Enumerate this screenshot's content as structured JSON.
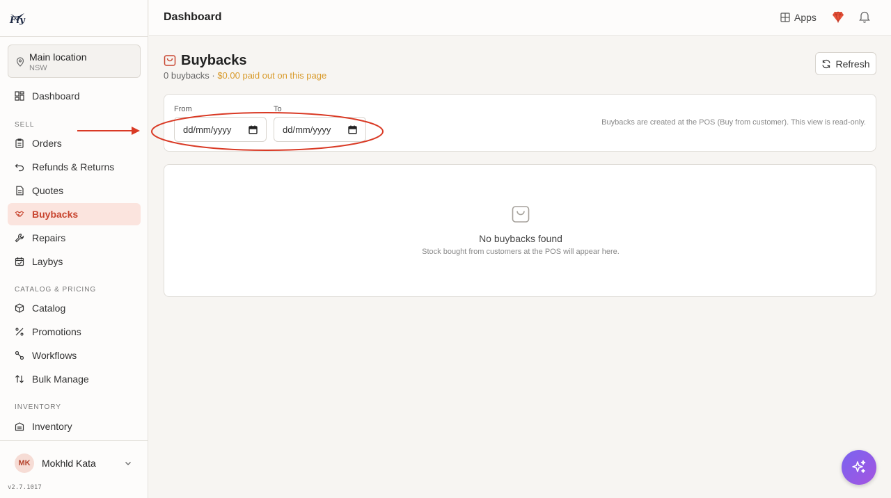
{
  "app": {
    "logo_text": "Fly"
  },
  "location": {
    "name": "Main location",
    "region": "NSW"
  },
  "nav": {
    "dashboard": "Dashboard",
    "section_sell": "SELL",
    "orders": "Orders",
    "refunds": "Refunds & Returns",
    "quotes": "Quotes",
    "buybacks": "Buybacks",
    "repairs": "Repairs",
    "laybys": "Laybys",
    "section_catalog": "CATALOG & PRICING",
    "catalog": "Catalog",
    "promotions": "Promotions",
    "workflows": "Workflows",
    "bulk_manage": "Bulk Manage",
    "section_inventory": "INVENTORY",
    "inventory": "Inventory"
  },
  "user": {
    "initials": "MK",
    "name": "Mokhld Kata"
  },
  "version": "v2.7.1017",
  "topbar": {
    "title": "Dashboard",
    "apps_label": "Apps"
  },
  "page": {
    "title": "Buybacks",
    "count_text": "0 buybacks · ",
    "paid_text": "$0.00 paid out on this page",
    "refresh_label": "Refresh"
  },
  "filters": {
    "from_label": "From",
    "to_label": "To",
    "from_value": "dd/mm/yyyy",
    "to_value": "dd/mm/yyyy",
    "hint": "Buybacks are created at the POS (Buy from customer). This view is read-only."
  },
  "empty": {
    "title": "No buybacks found",
    "subtitle": "Stock bought from customers at the POS will appear here."
  },
  "colors": {
    "accent": "#c8452f",
    "annotation": "#d93a25",
    "paid": "#d89a2a",
    "fab": "#8b5cf0"
  }
}
